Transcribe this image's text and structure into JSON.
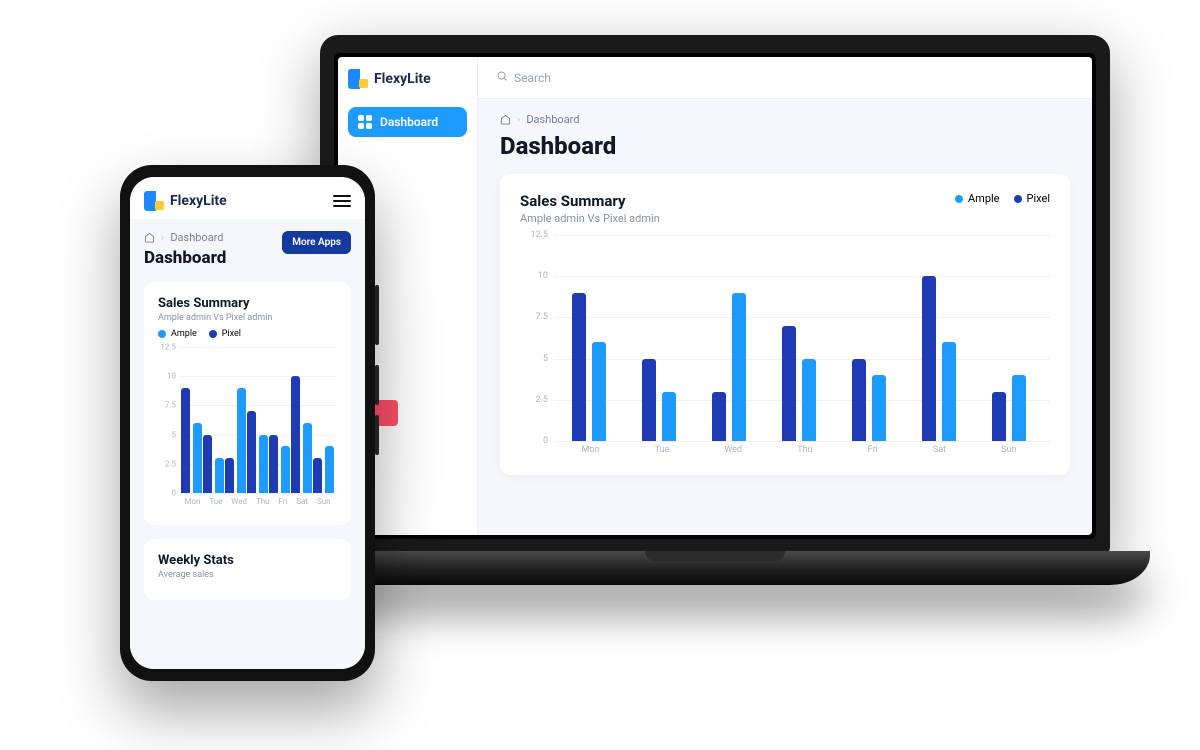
{
  "brand": "FlexyLite",
  "search_placeholder": "Search",
  "nav": {
    "dashboard": "Dashboard"
  },
  "breadcrumb": {
    "current": "Dashboard"
  },
  "page_title": "Dashboard",
  "more_apps_btn": "More Apps",
  "card": {
    "title": "Sales Summary",
    "subtitle": "Ample admin Vs Pixel admin"
  },
  "second_card": {
    "title": "Weekly Stats",
    "subtitle": "Average sales"
  },
  "legend": {
    "ample": "Ample",
    "pixel": "Pixel"
  },
  "colors": {
    "ample": "#1e9bff",
    "pixel": "#1f3bb3",
    "accent_pink": "#ff4f6b"
  },
  "chart_data": {
    "type": "bar",
    "title": "Sales Summary",
    "xlabel": "",
    "ylabel": "",
    "ylim": [
      0,
      12.5
    ],
    "y_ticks": [
      0,
      2.5,
      5,
      7.5,
      10,
      12.5
    ],
    "categories": [
      "Mon",
      "Tue",
      "Wed",
      "Thu",
      "Fri",
      "Sat",
      "Sun"
    ],
    "series": [
      {
        "name": "Pixel",
        "color": "#1f3bb3",
        "values": [
          9,
          5,
          3,
          7,
          5,
          10,
          3
        ]
      },
      {
        "name": "Ample",
        "color": "#1e9bff",
        "values": [
          6,
          3,
          9,
          5,
          4,
          6,
          4
        ]
      }
    ]
  }
}
